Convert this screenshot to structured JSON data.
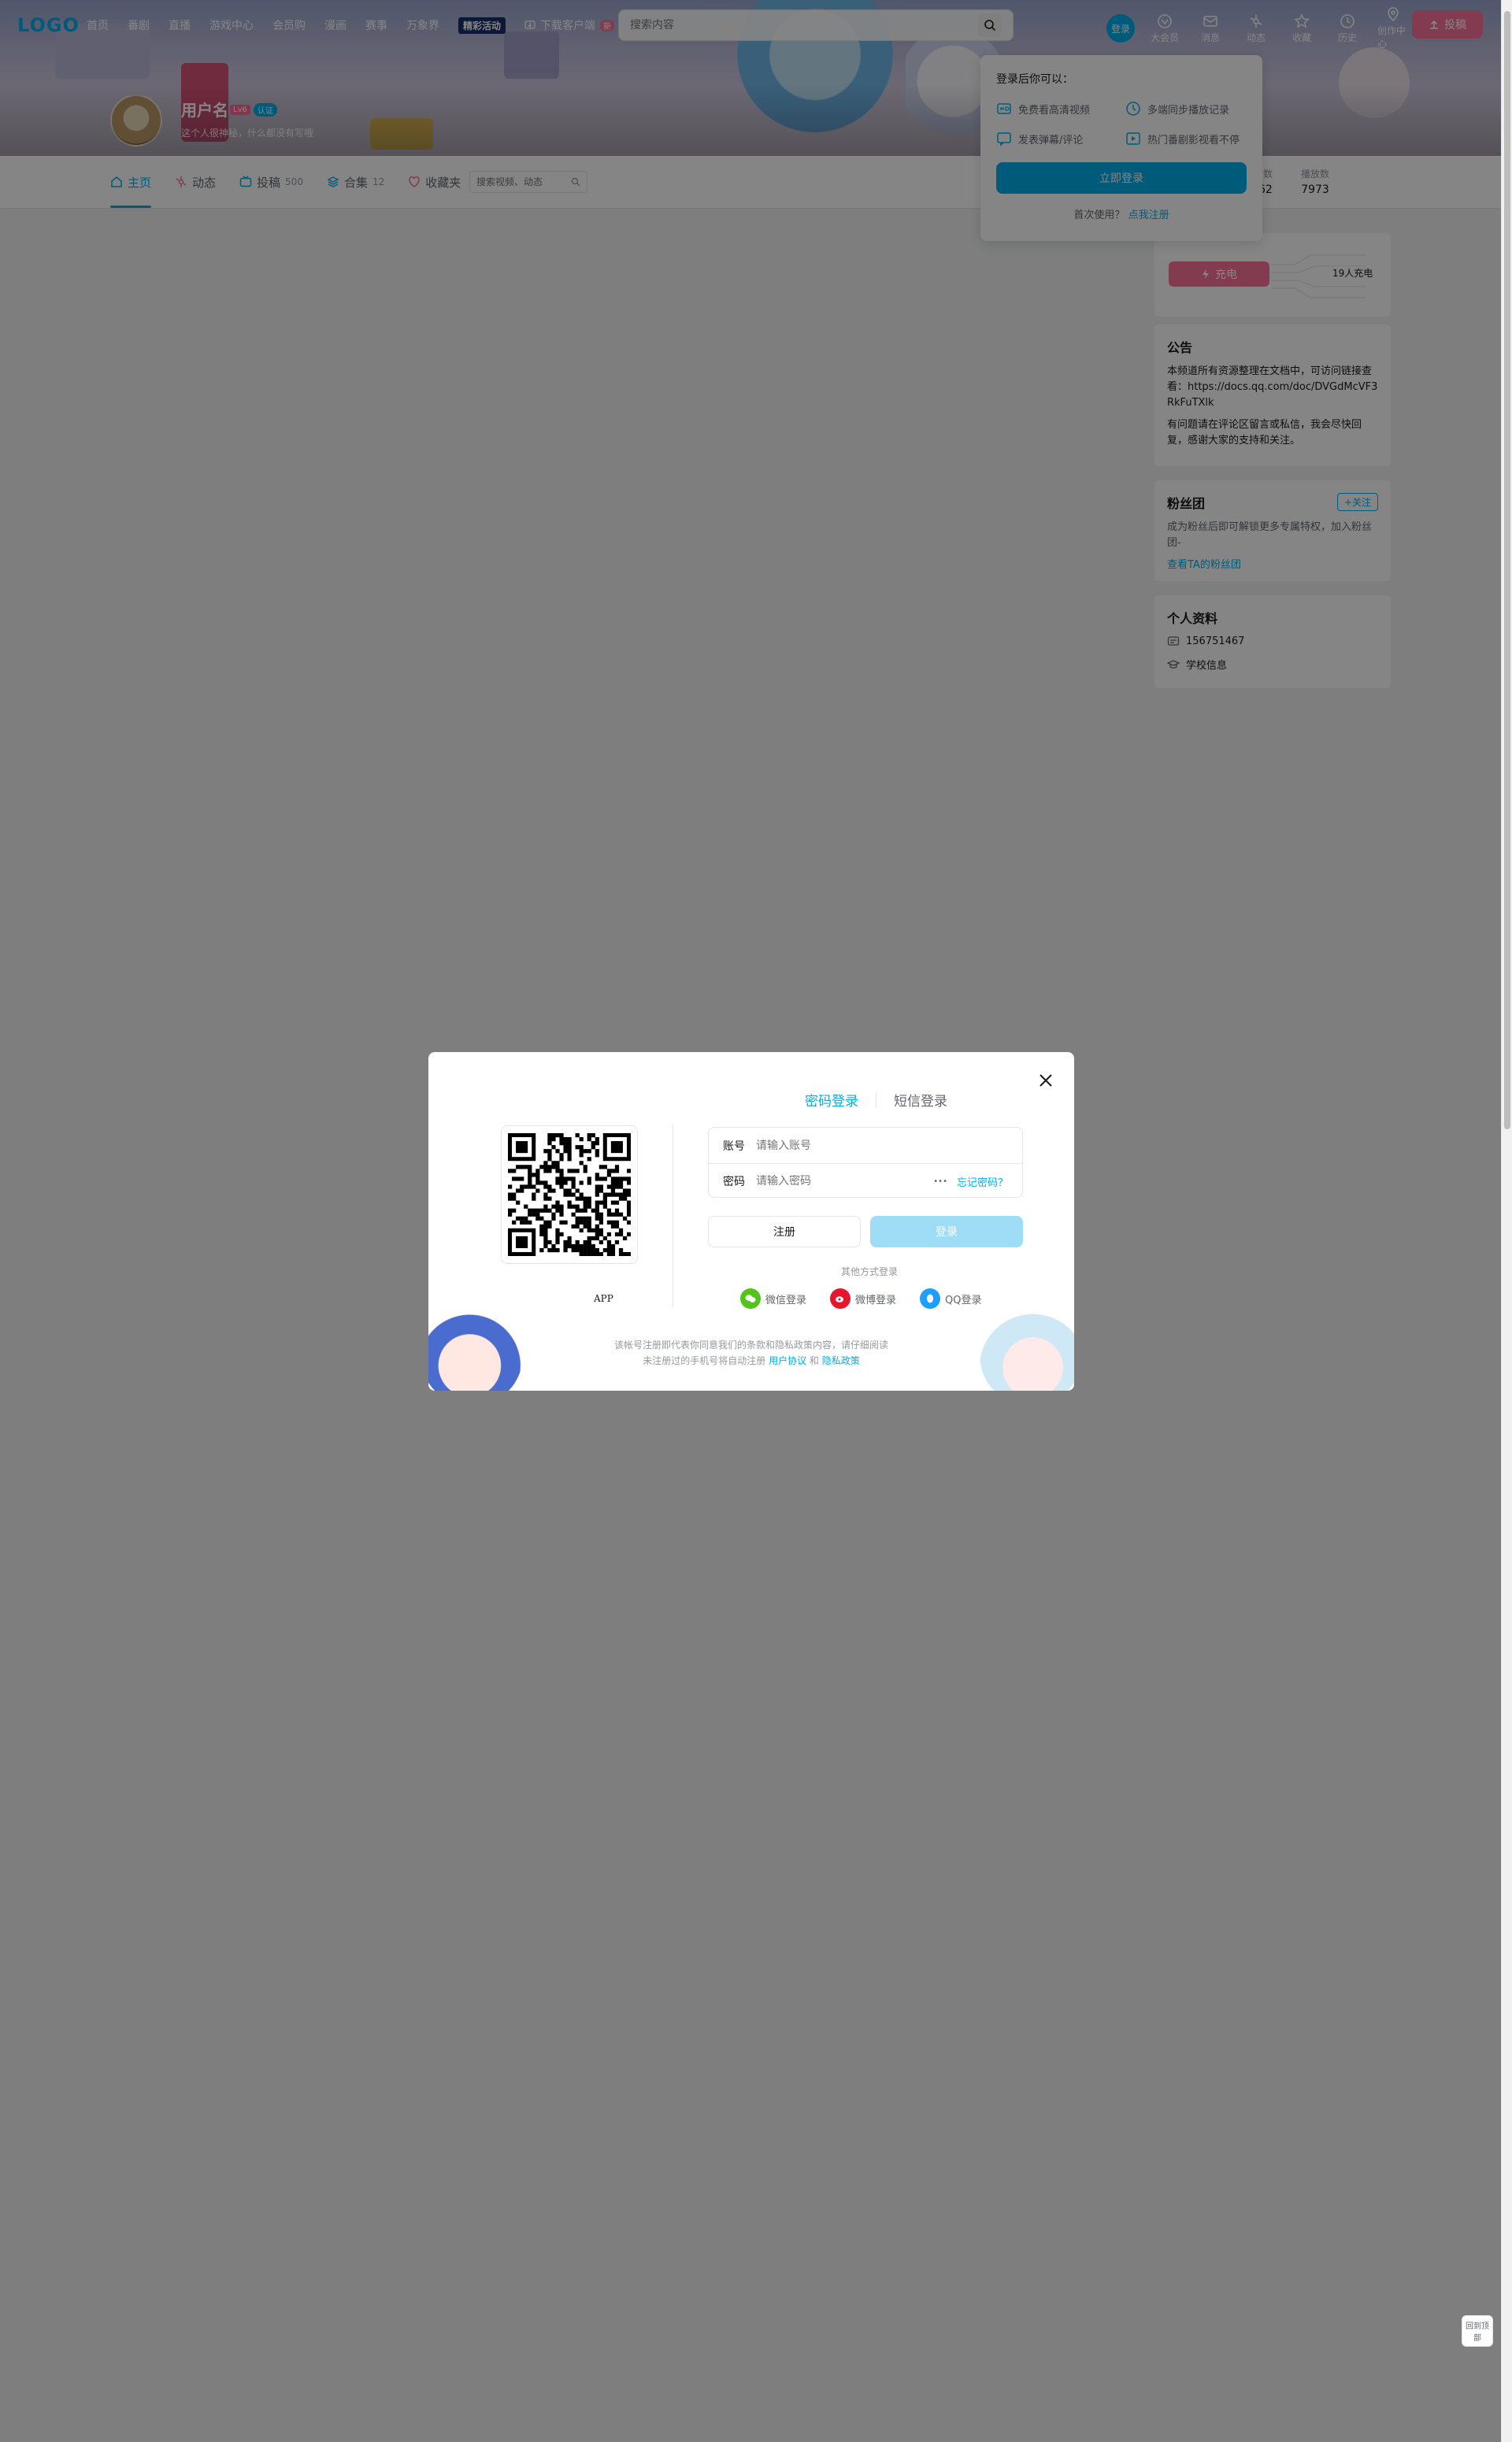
{
  "header": {
    "logo": "LOGO",
    "nav": [
      "首页",
      "番剧",
      "直播",
      "游戏中心",
      "会员购",
      "漫画",
      "赛事",
      "万象界"
    ],
    "game_badge": "精彩活动",
    "download_label": "下载客户端",
    "download_badge": "新",
    "search_placeholder": "搜索内容",
    "login_label": "登录",
    "icons": [
      {
        "name": "big-member",
        "label": "大会员"
      },
      {
        "name": "message",
        "label": "消息"
      },
      {
        "name": "dynamic",
        "label": "动态"
      },
      {
        "name": "favorite",
        "label": "收藏"
      },
      {
        "name": "history",
        "label": "历史"
      },
      {
        "name": "creation",
        "label": "创作中心"
      }
    ],
    "upload_label": "投稿"
  },
  "profile": {
    "username": "用户名",
    "level": "Lv6",
    "tag": "认证",
    "sign": "这个人很神秘，什么都没有写哦"
  },
  "tabs": [
    {
      "label": "主页",
      "count": ""
    },
    {
      "label": "动态",
      "count": ""
    },
    {
      "label": "投稿",
      "count": "500"
    },
    {
      "label": "合集",
      "count": "12"
    },
    {
      "label": "收藏夹",
      "count": ""
    }
  ],
  "tab_search_placeholder": "搜索视频、动态",
  "stats": [
    {
      "label": "获赞数",
      "value": "1062"
    },
    {
      "label": "播放数",
      "value": "7973"
    }
  ],
  "charge": {
    "button": "充电",
    "count": "19人充电"
  },
  "notice": {
    "title": "公告",
    "p1": "本频道所有资源整理在文档中，可访问链接查看：https://docs.qq.com/doc/DVGdMcVF3RkFuTXlk",
    "p2": "有问题请在评论区留言或私信，我会尽快回复，感谢大家的支持和关注。"
  },
  "fans": {
    "title": "粉丝团",
    "follow": "+关注",
    "text": "成为粉丝后即可解锁更多专属特权，加入粉丝团-",
    "link": "查看TA的粉丝团"
  },
  "info": {
    "title": "个人资料",
    "uid": "156751467",
    "school": "学校信息"
  },
  "popover": {
    "title": "登录后你可以：",
    "items": [
      "免费看高清视频",
      "多端同步播放记录",
      "发表弹幕/评论",
      "热门番剧影视看不停"
    ],
    "login": "立即登录",
    "register_prefix": "首次使用？",
    "register_link": "点我注册"
  },
  "modal": {
    "tab_password": "密码登录",
    "tab_sms": "短信登录",
    "qr_caption": "APP",
    "account_label": "账号",
    "account_placeholder": "请输入账号",
    "password_label": "密码",
    "password_placeholder": "请输入密码",
    "eye": "•••",
    "forgot": "忘记密码？",
    "register": "注册",
    "login": "登录",
    "other_title": "其他方式登录",
    "socials": [
      {
        "label": "微信登录",
        "color": "#52c41a"
      },
      {
        "label": "微博登录",
        "color": "#e6162d"
      },
      {
        "label": "QQ登录",
        "color": "#1e9eff"
      }
    ],
    "agreement_line1": "该帐号注册即代表你同意我们的条款和隐私政策内容，请仔细阅读",
    "agreement_line2_prefix": "未注册过的手机号将自动注册",
    "agreement_link1": "用户协议",
    "agreement_and": "和",
    "agreement_link2": "隐私政策"
  },
  "back_top": "回到顶部",
  "colors": {
    "brand_blue": "#00aeec",
    "brand_pink": "#fb7299",
    "overlay": "rgba(0,0,0,.48)"
  }
}
